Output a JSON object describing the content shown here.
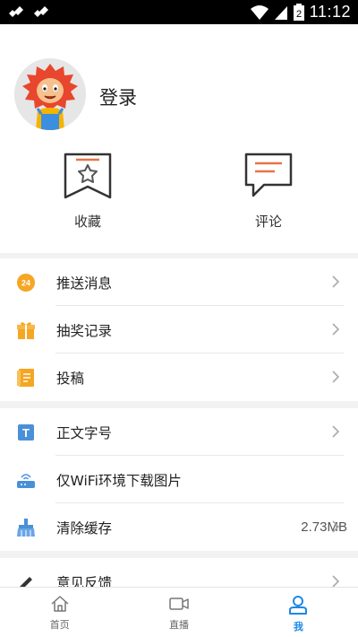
{
  "status_bar": {
    "time": "11:12",
    "battery_level": "2"
  },
  "profile": {
    "login_label": "登录"
  },
  "actions": [
    {
      "label": "收藏",
      "icon": "bookmark-star-icon"
    },
    {
      "label": "评论",
      "icon": "comment-icon"
    }
  ],
  "menu": {
    "group1": [
      {
        "label": "推送消息",
        "icon": "push-24-icon"
      },
      {
        "label": "抽奖记录",
        "icon": "gift-icon"
      },
      {
        "label": "投稿",
        "icon": "notebook-icon"
      }
    ],
    "group2": [
      {
        "label": "正文字号",
        "icon": "text-size-icon"
      },
      {
        "label": "仅WiFi环境下载图片",
        "icon": "router-icon"
      },
      {
        "label": "清除缓存",
        "icon": "broom-icon",
        "value": "2.73MB"
      }
    ],
    "group3": [
      {
        "label": "意见反馈",
        "icon": "pencil-icon"
      }
    ]
  },
  "tabs": [
    {
      "label": "首页",
      "icon": "home-icon"
    },
    {
      "label": "直播",
      "icon": "video-camera-icon"
    },
    {
      "label": "我",
      "icon": "person-icon"
    }
  ],
  "colors": {
    "accent": "#1e88e5",
    "orange": "#f5a623",
    "red_orange": "#e8734a"
  }
}
